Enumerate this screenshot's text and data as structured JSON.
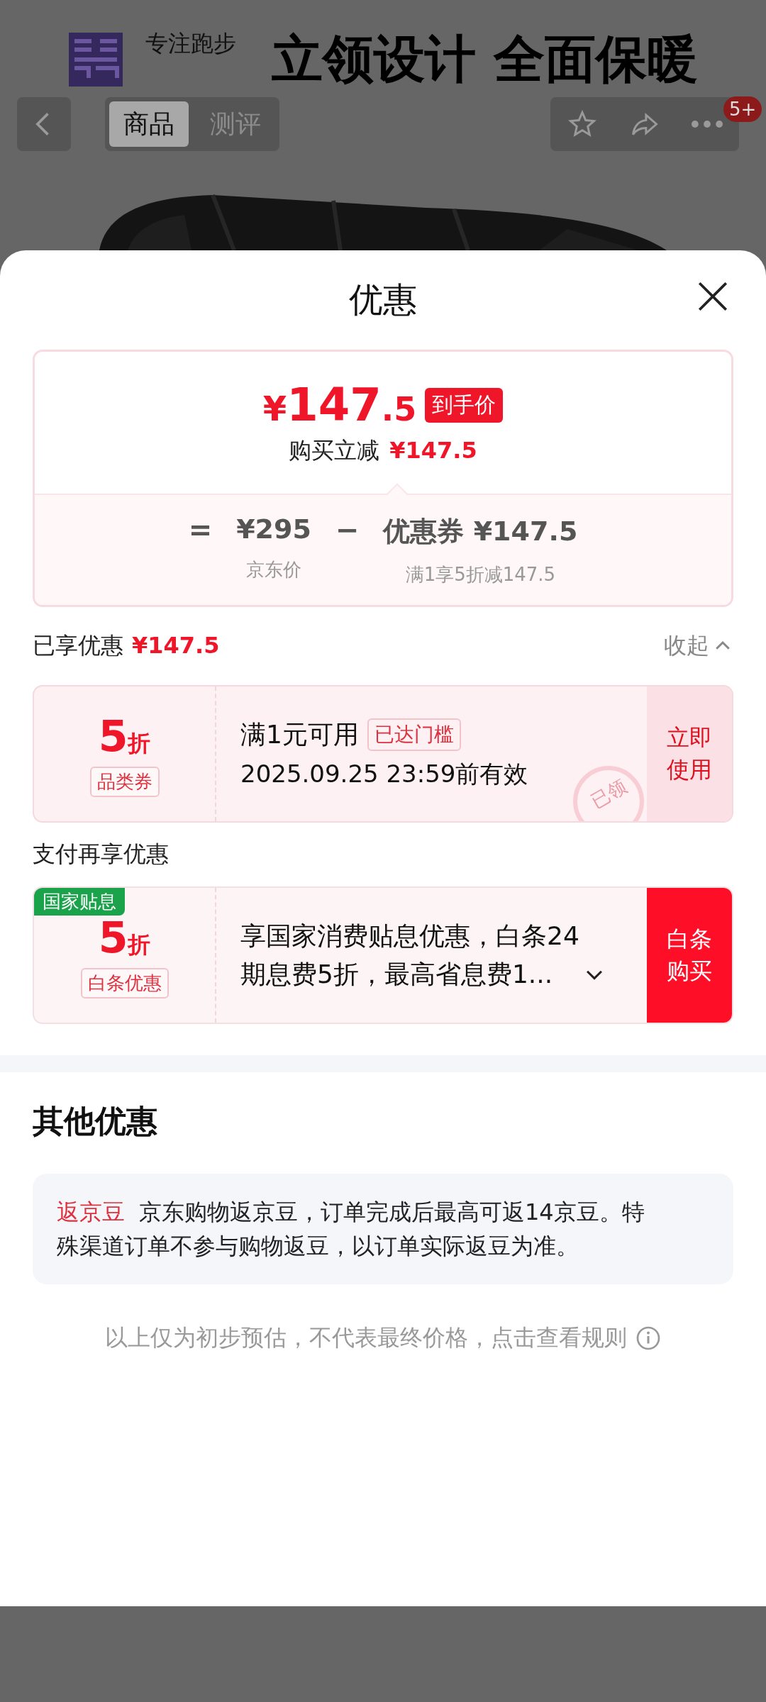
{
  "background_page": {
    "banner": {
      "slogan": "专注跑步",
      "headline": "立领设计 全面保暖"
    },
    "nav": {
      "tabs": [
        {
          "label": "商品",
          "selected": true
        },
        {
          "label": "测评",
          "selected": false
        }
      ],
      "badge": "5+"
    }
  },
  "sheet": {
    "title": "优惠",
    "price_card": {
      "price": {
        "symbol": "¥",
        "whole": "147",
        "fraction": ".5"
      },
      "price_tag": "到手价",
      "saving_label": "购买立减",
      "saving_value": "¥147.5",
      "formula": {
        "equals": "=",
        "minus": "−",
        "terms": [
          {
            "value": "¥295",
            "label": "京东价"
          },
          {
            "value": "优惠券 ¥147.5",
            "label": "满1享5折减147.5"
          }
        ]
      }
    },
    "enjoyed": {
      "label": "已享优惠",
      "value": "¥147.5",
      "toggle": "收起",
      "expanded": true
    },
    "coupons": [
      {
        "kind": "coupon",
        "discount": "5",
        "unit": "折",
        "type_label": "品类券",
        "condition": "满1元可用",
        "status_tag": "已达门槛",
        "validity": "2025.09.25 23:59前有效",
        "action": "立即使用",
        "stamp": "已领"
      }
    ],
    "payment_section": {
      "title": "支付再享优惠",
      "offers": [
        {
          "kind": "payment",
          "corner_tag": "国家贴息",
          "discount": "5",
          "unit": "折",
          "type_label": "白条优惠",
          "description": "享国家消费贴息优惠，白条24期息费5折，最高省息费1...",
          "action": "白条购买"
        }
      ]
    },
    "other_offers": {
      "title": "其他优惠",
      "items": [
        {
          "tag": "返京豆",
          "text": "京东购物返京豆，订单完成后最高可返14京豆。特殊渠道订单不参与购物返豆，以订单实际返豆为准。"
        }
      ]
    },
    "footer_note": "以上仅为初步预估，不代表最终价格，点击查看规则"
  }
}
